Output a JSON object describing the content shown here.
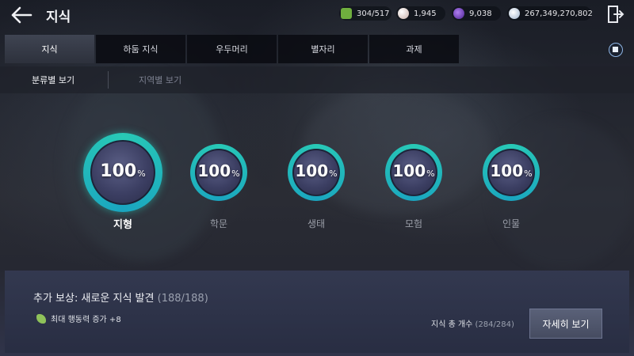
{
  "header": {
    "title": "지식",
    "back_icon": "arrow-left-icon",
    "exit_icon": "exit-door-icon"
  },
  "currencies": [
    {
      "icon": "energy-icon",
      "value": "304/517",
      "color": "#6fae3e"
    },
    {
      "icon": "pearl-icon",
      "value": "1,945",
      "color": "#d8c4c0"
    },
    {
      "icon": "crystal-icon",
      "value": "9,038",
      "color": "#6a3fb8"
    },
    {
      "icon": "silver-icon",
      "value": "267,349,270,802",
      "color": "#bfcde0"
    }
  ],
  "tabs": [
    {
      "label": "지식",
      "active": true
    },
    {
      "label": "하둠 지식",
      "active": false
    },
    {
      "label": "우두머리",
      "active": false
    },
    {
      "label": "별자리",
      "active": false
    },
    {
      "label": "과제",
      "active": false
    }
  ],
  "subtabs": {
    "active": "분류별 보기",
    "inactive": "지역별 보기"
  },
  "categories": [
    {
      "label": "지형",
      "percent": "100",
      "unit": "%",
      "selected": true
    },
    {
      "label": "학문",
      "percent": "100",
      "unit": "%",
      "selected": false
    },
    {
      "label": "생태",
      "percent": "100",
      "unit": "%",
      "selected": false
    },
    {
      "label": "모험",
      "percent": "100",
      "unit": "%",
      "selected": false
    },
    {
      "label": "인물",
      "percent": "100",
      "unit": "%",
      "selected": false
    }
  ],
  "bottom": {
    "reward_title": "추가 보상: 새로운 지식 발견",
    "reward_count": "(188/188)",
    "effect_icon": "leaf-icon",
    "effect_text": "최대 행동력 증가 +8",
    "total_label": "지식 총 개수",
    "total_count": "(284/284)",
    "detail_button": "자세히 보기"
  },
  "colors": {
    "ring": "#28c9b6",
    "active_tab": "#3f4452",
    "button": "#5a6178"
  }
}
